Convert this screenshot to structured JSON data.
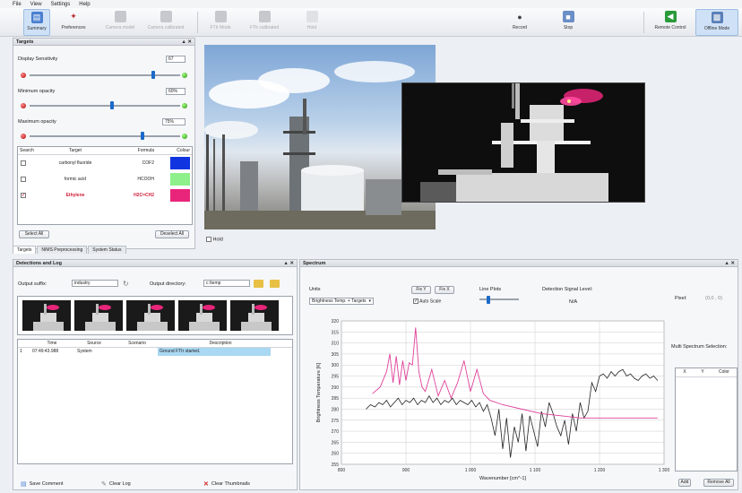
{
  "menu": [
    "File",
    "View",
    "Settings",
    "Help"
  ],
  "toolbar": {
    "summary": "Summary",
    "preferences": "Preferences",
    "camera_model": "Camera model",
    "camera_calibrated": "Camera calibrated",
    "fti_mode": "FTIr Mode",
    "fti_calibrated": "FTIr calibrated",
    "hold": "Hold",
    "record": "Record",
    "stop": "Stop",
    "remote_control": "Remote Control",
    "offline_mode": "Offline Mode"
  },
  "targets_panel": {
    "title": "Targets",
    "display_sensitivity": "Display Sensitivity",
    "display_sensitivity_value": "67",
    "minimum_opacity": "Minimum opacity",
    "minimum_opacity_value": "60%",
    "maximum_opacity": "Maximum opacity",
    "maximum_opacity_value": "75%",
    "sens_level": 0.82,
    "min_level": 0.55,
    "max_level": 0.75,
    "columns": [
      "Search",
      "Target",
      "Formula",
      "Colour"
    ],
    "rows": [
      {
        "target": "carbonyl fluoride",
        "formula": "COF2",
        "colour": "#1035e0",
        "checked": false,
        "highlight": false
      },
      {
        "target": "formic acid",
        "formula": "HCOOH",
        "colour": "#8ef08a",
        "checked": false,
        "highlight": false
      },
      {
        "target": "Ethylene",
        "formula": "H2C=CH2",
        "colour": "#e8257a",
        "checked": true,
        "highlight": true
      }
    ],
    "select_all": "Select All",
    "deselect_all": "Deselect All",
    "tabs": [
      "Targets",
      "NIMS Preprocessing",
      "System Status"
    ]
  },
  "video": {
    "hold_label": "Hold"
  },
  "detection": {
    "title": "Detections and Log",
    "output_suffix_label": "Output suffix:",
    "output_suffix_value": "industry",
    "output_directory_label": "Output directory:",
    "output_directory_value": "c:\\temp",
    "log_columns": [
      "Time",
      "Source",
      "Scenario",
      "Description"
    ],
    "log_rows": [
      {
        "index": "1",
        "time": "07:49:43.988",
        "source": "System",
        "scenario": "",
        "description": "Ground FTIr started."
      }
    ],
    "save_comment": "Save Comment",
    "clear_log": "Clear Log",
    "clear_thumbnails": "Clear Thumbnails"
  },
  "spectrum": {
    "title": "Spectrum",
    "units_label": "Units",
    "units_value": "Brightness Temp. + Targets",
    "fix_y": "Fix Y",
    "fix_x": "Fix X",
    "auto_scale": "Auto Scale",
    "line_plots_label": "Line Plots",
    "detection_signal_label": "Detection Signal Level:",
    "detection_signal_value": "N/A",
    "pixel_label": "Pixel:",
    "pixel_value": "(0,0 , 0)",
    "multi_spectrum": "Multi Spectrum Selection:",
    "multi_columns": [
      "X",
      "Y",
      "Color"
    ],
    "add": "Add",
    "remove_all": "Remove All"
  },
  "chart_data": {
    "type": "line",
    "xlabel": "Wavenumber [cm^-1]",
    "ylabel": "Brightness Temperature [K]",
    "xlim": [
      800,
      1300
    ],
    "ylim": [
      255,
      320
    ],
    "x_ticks": [
      "800",
      "900",
      "1 000",
      "1 100",
      "1 200",
      "1 300"
    ],
    "y_ticks": [
      "255",
      "260",
      "265",
      "270",
      "275",
      "280",
      "285",
      "290",
      "295",
      "300",
      "305",
      "310",
      "315",
      "320"
    ],
    "series": [
      {
        "color": "#222222",
        "x": [
          838,
          845,
          852,
          858,
          864,
          870,
          876,
          882,
          888,
          894,
          900,
          906,
          912,
          918,
          924,
          930,
          936,
          942,
          948,
          954,
          960,
          966,
          972,
          978,
          984,
          990,
          996,
          1002,
          1008,
          1014,
          1020,
          1026,
          1032,
          1038,
          1044,
          1050,
          1056,
          1062,
          1068,
          1074,
          1080,
          1086,
          1092,
          1098,
          1104,
          1110,
          1116,
          1122,
          1128,
          1134,
          1140,
          1146,
          1152,
          1158,
          1164,
          1170,
          1176,
          1182,
          1188,
          1194,
          1200,
          1206,
          1212,
          1218,
          1224,
          1230,
          1236,
          1242,
          1248,
          1254,
          1260,
          1266,
          1272,
          1278,
          1284,
          1290
        ],
        "y": [
          280,
          282,
          281,
          283,
          282,
          284,
          281,
          283,
          285,
          282,
          284,
          283,
          285,
          282,
          284,
          283,
          286,
          283,
          285,
          282,
          284,
          283,
          285,
          282,
          284,
          283,
          282,
          284,
          281,
          283,
          279,
          282,
          276,
          268,
          280,
          262,
          276,
          258,
          272,
          265,
          278,
          261,
          277,
          270,
          263,
          279,
          272,
          283,
          278,
          272,
          268,
          275,
          264,
          278,
          270,
          283,
          276,
          279,
          292,
          288,
          295,
          296,
          294,
          297,
          295,
          297,
          298,
          295,
          296,
          294,
          293,
          295,
          296,
          294,
          295,
          293
        ]
      },
      {
        "color": "#e0409a",
        "x": [
          848,
          860,
          870,
          875,
          880,
          885,
          890,
          895,
          900,
          905,
          910,
          915,
          920,
          925,
          930,
          940,
          950,
          960,
          970,
          980,
          990,
          1000,
          1010,
          1020,
          1030,
          1050,
          1080,
          1110,
          1140,
          1170,
          1200,
          1230,
          1260,
          1290
        ],
        "y": [
          287,
          290,
          297,
          305,
          292,
          304,
          291,
          302,
          293,
          301,
          300,
          317,
          297,
          290,
          288,
          298,
          286,
          293,
          285,
          292,
          302,
          288,
          298,
          287,
          284,
          282,
          280,
          278,
          277,
          276,
          276,
          276,
          276,
          276
        ]
      }
    ]
  }
}
